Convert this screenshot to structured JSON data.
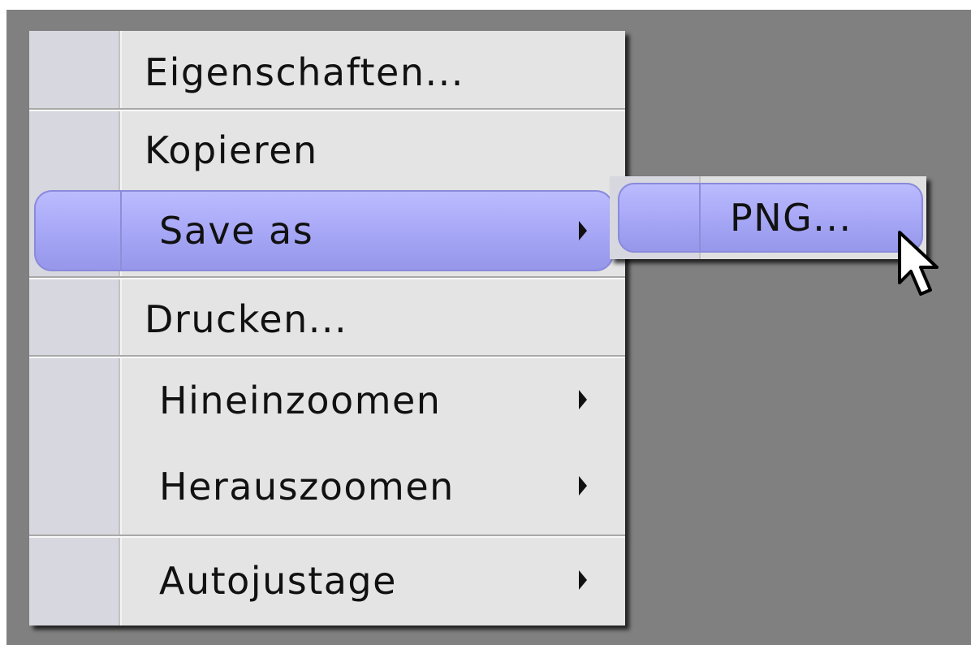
{
  "context_menu": {
    "items": [
      {
        "label": "Eigenschaften...",
        "has_submenu": false
      },
      {
        "label": "Kopieren",
        "has_submenu": false
      },
      {
        "label": "Save as",
        "has_submenu": true,
        "state": "highlighted"
      },
      {
        "label": "Drucken...",
        "has_submenu": false
      },
      {
        "label": "Hineinzoomen",
        "has_submenu": true
      },
      {
        "label": "Herauszoomen",
        "has_submenu": true
      },
      {
        "label": "Autojustage",
        "has_submenu": true
      }
    ]
  },
  "submenu": {
    "parent": "Save as",
    "items": [
      {
        "label": "PNG...",
        "state": "highlighted"
      }
    ]
  },
  "colors": {
    "backdrop": "#808080",
    "menu_background": "#e4e4e4",
    "gutter": "#d7d7df",
    "highlight": "#a6a6f6"
  },
  "icons": {
    "submenu_indicator": "triangle-right-icon",
    "pointer": "mouse-cursor-icon"
  }
}
